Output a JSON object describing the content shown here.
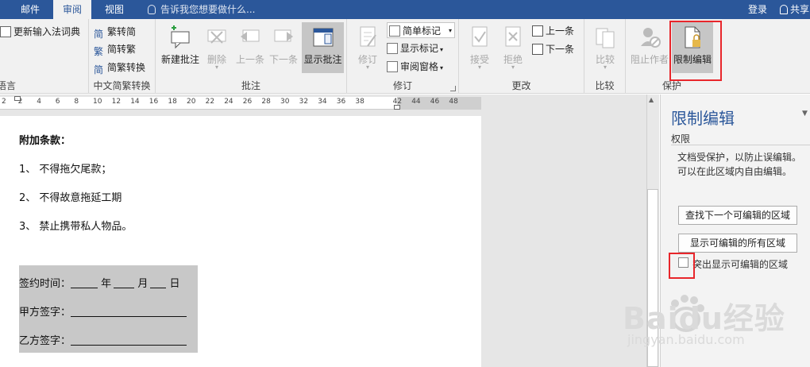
{
  "tabs": {
    "mail": "邮件",
    "review": "审阅",
    "view": "视图",
    "tell_me": "告诉我您想要做什么...",
    "login": "登录",
    "share": "共享"
  },
  "ribbon": {
    "language": {
      "update_ime": "更新输入法词典",
      "label": "语言"
    },
    "chinese": {
      "to_simplified": "繁转简",
      "to_traditional": "简转繁",
      "convert": "简繁转换",
      "label": "中文简繁转换"
    },
    "comments": {
      "new_comment": "新建批注",
      "delete": "删除",
      "previous": "上一条",
      "next": "下一条",
      "show_comments": "显示批注",
      "label": "批注"
    },
    "tracking": {
      "track_changes": "修订",
      "simple_markup": "简单标记",
      "show_markup": "显示标记",
      "reviewing_pane": "审阅窗格",
      "label": "修订"
    },
    "changes": {
      "accept": "接受",
      "reject": "拒绝",
      "previous": "上一条",
      "next": "下一条",
      "label": "更改"
    },
    "compare": {
      "compare": "比较",
      "label": "比较"
    },
    "protect": {
      "block_authors": "阻止作者",
      "restrict_editing": "限制编辑",
      "label": "保护"
    }
  },
  "ruler": {
    "ticks": [
      "2",
      "2",
      "4",
      "6",
      "8",
      "10",
      "12",
      "14",
      "16",
      "18",
      "20",
      "22",
      "24",
      "26",
      "28",
      "30",
      "32",
      "34",
      "36",
      "38",
      "",
      "42",
      "44",
      "46",
      "48"
    ]
  },
  "document": {
    "heading": "附加条款：",
    "items": [
      "1、 不得拖欠尾款；",
      "2、 不得故意拖延工期",
      "3、 禁止携带私人物品。"
    ],
    "sign_date_label": "签约时间：",
    "year": "年",
    "month": "月",
    "day": "日",
    "party_a": "甲方签字：",
    "party_b": "乙方签字："
  },
  "pane": {
    "title": "限制编辑",
    "subtitle": "权限",
    "desc_line1": "文档受保护，以防止误编辑。",
    "desc_line2": "可以在此区域内自由编辑。",
    "find_next": "查找下一个可编辑的区域",
    "show_all": "显示可编辑的所有区域",
    "highlight": "突出显示可编辑的区域"
  },
  "watermark": {
    "brand": "Baidu经验",
    "url": "jingyan.baidu.com"
  },
  "colors": {
    "accent": "#2b579a",
    "highlight_red": "#e8262b",
    "selection_grey": "#c8c8c8"
  }
}
